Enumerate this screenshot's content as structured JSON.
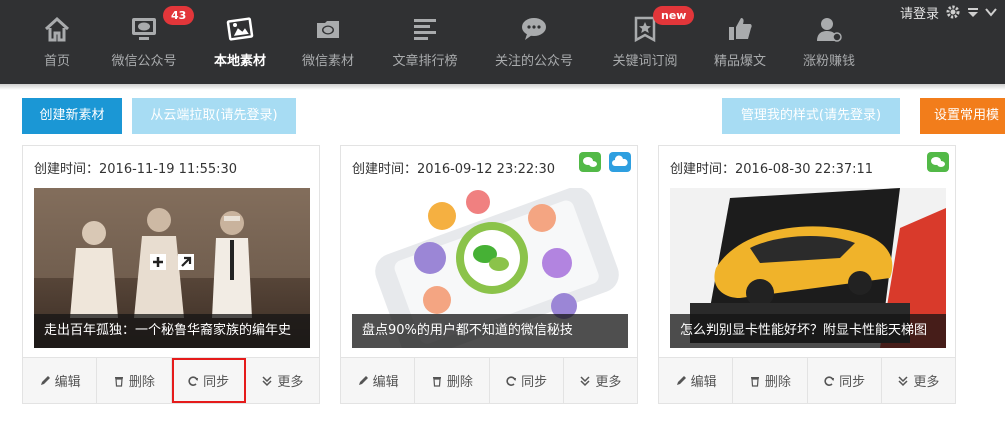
{
  "nav": {
    "items": [
      {
        "label": "首页",
        "icon": "home-icon"
      },
      {
        "label": "微信公众号",
        "icon": "wechat-account-icon",
        "badge": "43"
      },
      {
        "label": "本地素材",
        "icon": "local-material-icon",
        "active": true
      },
      {
        "label": "微信素材",
        "icon": "wechat-material-icon"
      },
      {
        "label": "文章排行榜",
        "icon": "ranking-icon"
      },
      {
        "label": "关注的公众号",
        "icon": "followed-accounts-icon"
      },
      {
        "label": "关键词订阅",
        "icon": "keyword-subscribe-icon",
        "badge": "new"
      },
      {
        "label": "精品爆文",
        "icon": "thumbs-up-icon"
      },
      {
        "label": "涨粉赚钱",
        "icon": "user-earn-icon"
      }
    ],
    "login_label": "请登录"
  },
  "toolbar": {
    "create_label": "创建新素材",
    "pull_label": "从云端拉取(请先登录)",
    "manage_style_label": "管理我的样式(请先登录)",
    "set_common_label": "设置常用模"
  },
  "cards": [
    {
      "time": "创建时间：2016-11-19 11:55:30",
      "title": "走出百年孤独：一个秘鲁华裔家族的编年史",
      "badges": []
    },
    {
      "time": "创建时间：2016-09-12 23:22:30",
      "title": "盘点90%的用户都不知道的微信秘技",
      "badges": [
        "wechat",
        "cloud"
      ]
    },
    {
      "time": "创建时间：2016-08-30 22:37:11",
      "title": "怎么判别显卡性能好坏？附显卡性能天梯图",
      "badges": [
        "wechat"
      ]
    }
  ],
  "actions": {
    "edit": "编辑",
    "delete": "删除",
    "sync": "同步",
    "more": "更多"
  },
  "colors": {
    "nav_bg": "#303133",
    "primary": "#1b97d5",
    "light": "#a7dcf3",
    "orange": "#f27d1b",
    "badge_red": "#e2363a",
    "wechat_green": "#52b947",
    "cloud_blue": "#2e9fe0",
    "highlight_red": "#e51b1b"
  }
}
